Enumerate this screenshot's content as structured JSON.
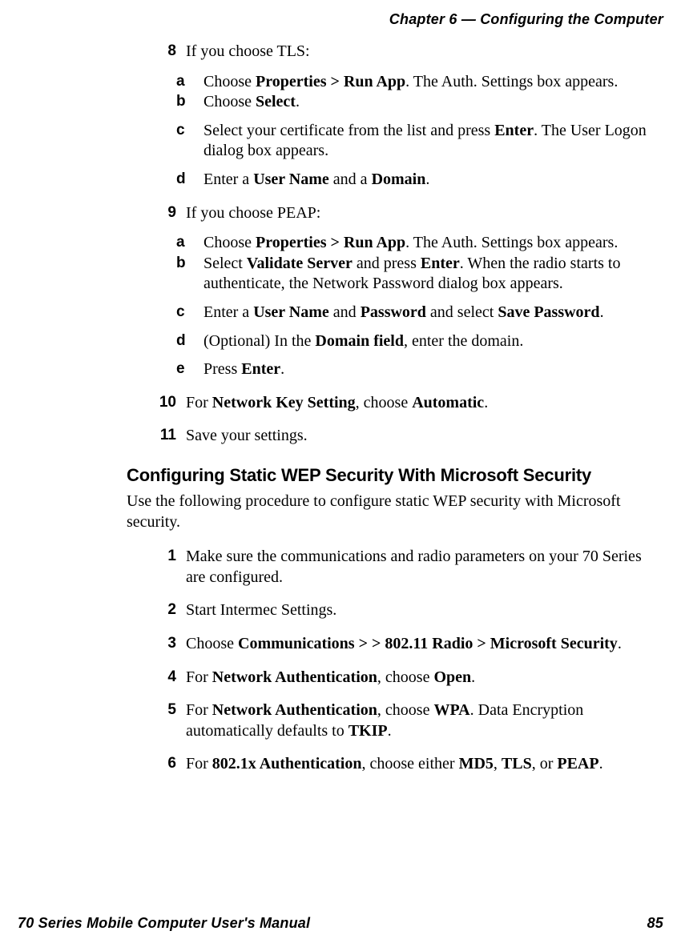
{
  "header": {
    "chapter": "Chapter 6 — Configuring the Computer"
  },
  "list": {
    "step8": {
      "num": "8",
      "text": "If you choose TLS:",
      "a": {
        "letter": "a",
        "html": "Choose <b>Properties > Run App</b>. The Auth. Settings box appears."
      },
      "b": {
        "letter": "b",
        "html": "Choose <b>Select</b>."
      },
      "c": {
        "letter": "c",
        "html": "Select your certificate from the list and press <b>Enter</b>. The User Logon dialog box appears."
      },
      "d": {
        "letter": "d",
        "html": "Enter a <b>User Name</b> and a <b>Domain</b>."
      }
    },
    "step9": {
      "num": "9",
      "text": "If you choose PEAP:",
      "a": {
        "letter": "a",
        "html": "Choose <b>Properties > Run App</b>. The Auth. Settings box appears."
      },
      "b": {
        "letter": "b",
        "html": "Select <b>Validate Server</b> and press <b>Enter</b>. When the radio starts to authenticate, the Network Password dialog box appears."
      },
      "c": {
        "letter": "c",
        "html": "Enter a <b>User Name</b> and <b>Password</b> and select <b>Save Password</b>."
      },
      "d": {
        "letter": "d",
        "html": "(Optional) In the <b>Domain field</b>, enter the domain."
      },
      "e": {
        "letter": "e",
        "html": "Press <b>Enter</b>."
      }
    },
    "step10": {
      "num": "10",
      "html": "For <b>Network Key Setting</b>, choose <b>Automatic</b>."
    },
    "step11": {
      "num": "11",
      "html": "Save your settings."
    }
  },
  "section": {
    "heading": "Configuring Static WEP Security With Microsoft Security",
    "intro": "Use the following procedure to configure static WEP security with Microsoft security.",
    "step1": {
      "num": "1",
      "html": "Make sure the communications and radio parameters on your 70 Series are configured."
    },
    "step2": {
      "num": "2",
      "html": "Start Intermec Settings."
    },
    "step3": {
      "num": "3",
      "html": "Choose <b>Communications >  > 802.11 Radio > Microsoft Security</b>."
    },
    "step4": {
      "num": "4",
      "html": "For <b>Network Authentication</b>, choose <b>Open</b>."
    },
    "step5": {
      "num": "5",
      "html": "For <b>Network Authentication</b>, choose <b>WPA</b>. Data Encryption automatically defaults to <b>TKIP</b>."
    },
    "step6": {
      "num": "6",
      "html": "For <b>802.1x Authentication</b>, choose either <b>MD5</b>, <b>TLS</b>, or <b>PEAP</b>."
    }
  },
  "footer": {
    "manual": "70 Series Mobile Computer User's Manual",
    "page": "85"
  }
}
